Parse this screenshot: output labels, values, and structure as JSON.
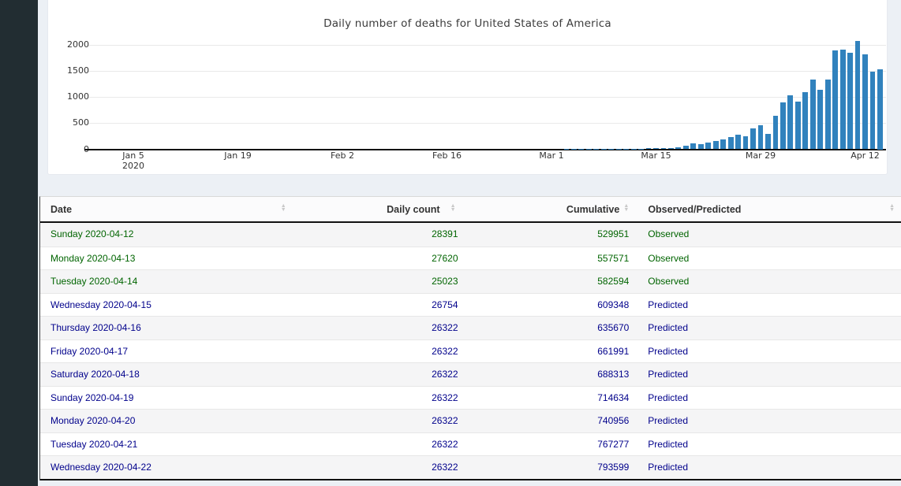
{
  "colors": {
    "sidebar": "#222d32",
    "page_background": "#ecf0f5",
    "bar": "#3182bd",
    "observed_text": "#006400",
    "predicted_text": "#00008b"
  },
  "chart_data": {
    "type": "bar",
    "title": "Daily number of deaths for United States of America",
    "bar_color": "#3182bd",
    "x_axis_start": "2020-01-05",
    "xtick_labels": [
      "Jan 5",
      "Jan 19",
      "Feb 2",
      "Feb 16",
      "Mar 1",
      "Mar 15",
      "Mar 29",
      "Apr 12"
    ],
    "xtick_year_sublabel": "2020",
    "ytick_values": [
      0,
      500,
      1000,
      1500,
      2000
    ],
    "ylim": [
      0,
      2100
    ],
    "grid": "horizontal",
    "note": "bars are ~0 from 2020-01-05 until 2020-02-29",
    "dates": [
      "2020-03-01",
      "2020-03-02",
      "2020-03-03",
      "2020-03-04",
      "2020-03-05",
      "2020-03-06",
      "2020-03-07",
      "2020-03-08",
      "2020-03-09",
      "2020-03-10",
      "2020-03-11",
      "2020-03-12",
      "2020-03-13",
      "2020-03-14",
      "2020-03-15",
      "2020-03-16",
      "2020-03-17",
      "2020-03-18",
      "2020-03-19",
      "2020-03-20",
      "2020-03-21",
      "2020-03-22",
      "2020-03-23",
      "2020-03-24",
      "2020-03-25",
      "2020-03-26",
      "2020-03-27",
      "2020-03-28",
      "2020-03-29",
      "2020-03-30",
      "2020-03-31",
      "2020-04-01",
      "2020-04-02",
      "2020-04-03",
      "2020-04-04",
      "2020-04-05",
      "2020-04-06",
      "2020-04-07",
      "2020-04-08",
      "2020-04-09",
      "2020-04-10",
      "2020-04-11",
      "2020-04-12",
      "2020-04-13",
      "2020-04-14"
    ],
    "values": [
      1,
      1,
      2,
      3,
      2,
      3,
      4,
      4,
      5,
      6,
      8,
      10,
      12,
      18,
      22,
      18,
      28,
      45,
      65,
      110,
      95,
      135,
      155,
      195,
      240,
      285,
      245,
      397,
      458,
      295,
      639,
      901,
      1038,
      912,
      1094,
      1330,
      1144,
      1336,
      1891,
      1912,
      1851,
      2073,
      1821,
      1482,
      1532
    ]
  },
  "table": {
    "columns": [
      {
        "label": "Date"
      },
      {
        "label": "Daily count"
      },
      {
        "label": "Cumulative"
      },
      {
        "label": "Observed/Predicted"
      }
    ],
    "status_colors": {
      "Observed": "#006400",
      "Predicted": "#00008b"
    },
    "rows": [
      {
        "date": "Sunday 2020-04-12",
        "daily": "28391",
        "cumulative": "529951",
        "status": "Observed"
      },
      {
        "date": "Monday 2020-04-13",
        "daily": "27620",
        "cumulative": "557571",
        "status": "Observed"
      },
      {
        "date": "Tuesday 2020-04-14",
        "daily": "25023",
        "cumulative": "582594",
        "status": "Observed"
      },
      {
        "date": "Wednesday 2020-04-15",
        "daily": "26754",
        "cumulative": "609348",
        "status": "Predicted"
      },
      {
        "date": "Thursday 2020-04-16",
        "daily": "26322",
        "cumulative": "635670",
        "status": "Predicted"
      },
      {
        "date": "Friday 2020-04-17",
        "daily": "26322",
        "cumulative": "661991",
        "status": "Predicted"
      },
      {
        "date": "Saturday 2020-04-18",
        "daily": "26322",
        "cumulative": "688313",
        "status": "Predicted"
      },
      {
        "date": "Sunday 2020-04-19",
        "daily": "26322",
        "cumulative": "714634",
        "status": "Predicted"
      },
      {
        "date": "Monday 2020-04-20",
        "daily": "26322",
        "cumulative": "740956",
        "status": "Predicted"
      },
      {
        "date": "Tuesday 2020-04-21",
        "daily": "26322",
        "cumulative": "767277",
        "status": "Predicted"
      },
      {
        "date": "Wednesday 2020-04-22",
        "daily": "26322",
        "cumulative": "793599",
        "status": "Predicted"
      }
    ]
  }
}
